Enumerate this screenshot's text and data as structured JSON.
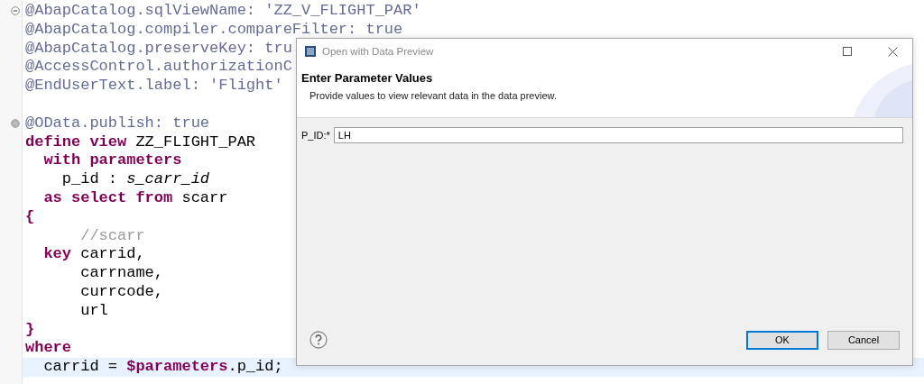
{
  "editor": {
    "lines": [
      {
        "expanded": true,
        "current": false,
        "segments": [
          {
            "kind": "annotation",
            "text": "@AbapCatalog.sqlViewName: 'ZZ_V_FLIGHT_PAR'"
          }
        ]
      },
      {
        "current": false,
        "segments": [
          {
            "kind": "annotation",
            "text": "@AbapCatalog.compiler.compareFilter: true"
          }
        ]
      },
      {
        "current": false,
        "segments": [
          {
            "kind": "annotation",
            "text": "@AbapCatalog.preserveKey: tru"
          }
        ]
      },
      {
        "current": false,
        "segments": [
          {
            "kind": "annotation",
            "text": "@AccessControl.authorizationC"
          }
        ]
      },
      {
        "current": false,
        "segments": [
          {
            "kind": "annotation",
            "text": "@EndUserText.label: 'Flight'"
          }
        ]
      },
      {
        "current": false
      },
      {
        "expanded": false,
        "current": false,
        "segments": [
          {
            "kind": "annotation",
            "text": "@OData.publish: true"
          }
        ]
      },
      {
        "current": false,
        "segments": [
          {
            "kind": "keyword",
            "text": "define view"
          },
          {
            "kind": "plain",
            "text": " ZZ_FLIGHT_PAR"
          }
        ]
      },
      {
        "current": false,
        "segments": [
          {
            "kind": "keyword",
            "text": "  with parameters"
          }
        ]
      },
      {
        "current": false,
        "segments": [
          {
            "kind": "plain",
            "text": "    p_id : "
          },
          {
            "kind": "type",
            "text": "s_carr_id"
          }
        ]
      },
      {
        "current": false,
        "segments": [
          {
            "kind": "keyword",
            "text": "  as select from"
          },
          {
            "kind": "plain",
            "text": " scarr"
          }
        ]
      },
      {
        "current": false,
        "segments": [
          {
            "kind": "keyword",
            "text": "{"
          }
        ]
      },
      {
        "current": false,
        "segments": [
          {
            "kind": "comment",
            "text": "      //scarr"
          }
        ]
      },
      {
        "current": false,
        "segments": [
          {
            "kind": "keyword",
            "text": "  key"
          },
          {
            "kind": "plain",
            "text": " carrid,"
          }
        ]
      },
      {
        "current": false,
        "segments": [
          {
            "kind": "plain",
            "text": "      carrname,"
          }
        ]
      },
      {
        "current": false,
        "segments": [
          {
            "kind": "plain",
            "text": "      currcode,"
          }
        ]
      },
      {
        "current": false,
        "segments": [
          {
            "kind": "plain",
            "text": "      url"
          }
        ]
      },
      {
        "current": false,
        "segments": [
          {
            "kind": "keyword",
            "text": "}"
          }
        ]
      },
      {
        "current": false,
        "segments": [
          {
            "kind": "keyword",
            "text": "where"
          }
        ]
      },
      {
        "current": true,
        "segments": [
          {
            "kind": "plain",
            "text": "  carrid = "
          },
          {
            "kind": "keyword",
            "text": "$parameters"
          },
          {
            "kind": "plain",
            "text": ".p_id;"
          }
        ]
      }
    ]
  },
  "dialog": {
    "title": "Open with Data Preview",
    "heading": "Enter Parameter Values",
    "description": "Provide values to view relevant data in the data preview.",
    "fields": [
      {
        "label": "P_ID:*",
        "value": "LH"
      }
    ],
    "buttons": [
      {
        "label": "OK",
        "default": true
      },
      {
        "label": "Cancel",
        "default": false
      }
    ]
  }
}
